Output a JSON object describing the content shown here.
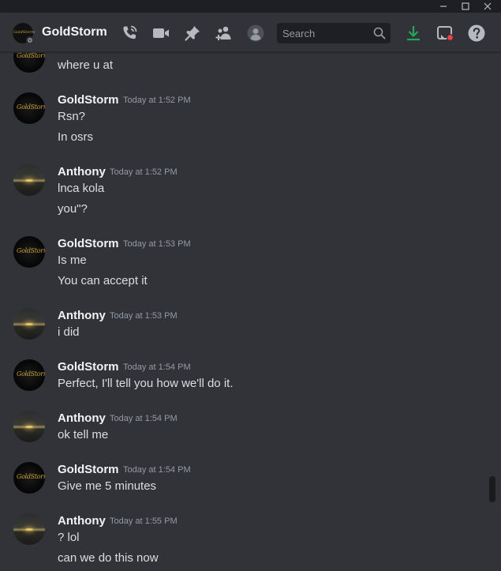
{
  "window": {
    "controls": [
      {
        "name": "minimize-icon"
      },
      {
        "name": "maximize-icon"
      },
      {
        "name": "close-icon"
      }
    ]
  },
  "header": {
    "title": "GoldStorm",
    "avatar_logo": "GoldStorm",
    "status": "offline",
    "search_placeholder": "Search",
    "icons": [
      "phone-call-icon",
      "video-call-icon",
      "pin-icon",
      "add-friends-icon",
      "user-profile-icon",
      "search-icon",
      "download-icon",
      "inbox-icon",
      "help-icon"
    ],
    "colors": {
      "download": "#23a55a",
      "notification_dot": "#f23f43"
    }
  },
  "messages": [
    {
      "author": "",
      "time": "",
      "lines": [
        "where u at"
      ]
    },
    {
      "author": "GoldStorm",
      "time": "Today at 1:52 PM",
      "lines": [
        "Rsn?",
        "In osrs"
      ]
    },
    {
      "author": "Anthony",
      "time": "Today at 1:52 PM",
      "lines": [
        "lnca kola",
        "you\"?"
      ]
    },
    {
      "author": "GoldStorm",
      "time": "Today at 1:53 PM",
      "lines": [
        "Is me",
        "You can accept it"
      ]
    },
    {
      "author": "Anthony",
      "time": "Today at 1:53 PM",
      "lines": [
        "i did"
      ]
    },
    {
      "author": "GoldStorm",
      "time": "Today at 1:54 PM",
      "lines": [
        "Perfect, I'll tell you how we'll do it."
      ]
    },
    {
      "author": "Anthony",
      "time": "Today at 1:54 PM",
      "lines": [
        "ok tell me"
      ]
    },
    {
      "author": "GoldStorm",
      "time": "Today at 1:54 PM",
      "lines": [
        "Give me 5 minutes"
      ]
    },
    {
      "author": "Anthony",
      "time": "Today at 1:55 PM",
      "lines": [
        "? lol",
        "can we do this now"
      ]
    }
  ]
}
